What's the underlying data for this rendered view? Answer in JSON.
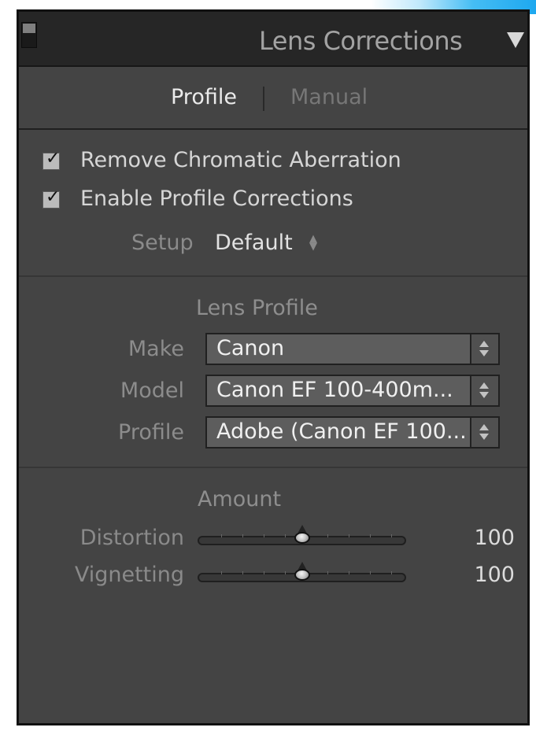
{
  "panel": {
    "title": "Lens Corrections"
  },
  "mode_tabs": {
    "profile": "Profile",
    "manual": "Manual"
  },
  "options": {
    "remove_chromatic_aberration": {
      "label": "Remove Chromatic Aberration",
      "checked": true
    },
    "enable_profile_corrections": {
      "label": "Enable Profile Corrections",
      "checked": true
    }
  },
  "setup": {
    "label": "Setup",
    "value": "Default"
  },
  "lens_profile": {
    "heading": "Lens Profile",
    "make_label": "Make",
    "make_value": "Canon",
    "model_label": "Model",
    "model_value": "Canon EF 100-400m...",
    "profile_label": "Profile",
    "profile_value": "Adobe (Canon EF 100..."
  },
  "amount": {
    "heading": "Amount",
    "distortion_label": "Distortion",
    "distortion_value": "100",
    "vignetting_label": "Vignetting",
    "vignetting_value": "100"
  },
  "icons": {
    "panel_switch": "panel-switch-icon",
    "collapse": "triangle-down-icon",
    "checkbox": "checkmark-icon",
    "spinner": "up-down-spinner-icon",
    "slider_thumb": "slider-thumb-icon"
  },
  "colors": {
    "panel_background": "#444444",
    "header_background": "#262626",
    "input_background": "#5d5d5d",
    "active_text": "#ebebeb",
    "muted_text": "#8c8c8c"
  }
}
